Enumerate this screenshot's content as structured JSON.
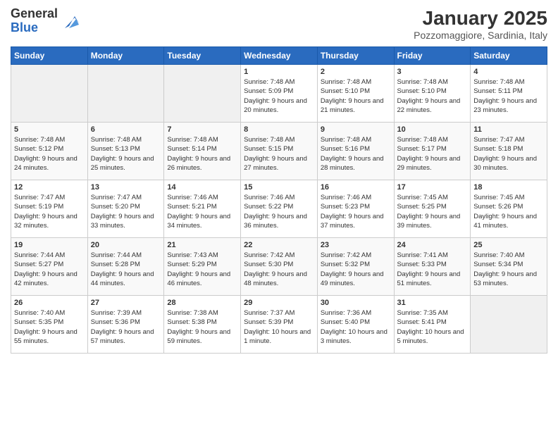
{
  "logo": {
    "general": "General",
    "blue": "Blue"
  },
  "title": "January 2025",
  "subtitle": "Pozzomaggiore, Sardinia, Italy",
  "headers": [
    "Sunday",
    "Monday",
    "Tuesday",
    "Wednesday",
    "Thursday",
    "Friday",
    "Saturday"
  ],
  "weeks": [
    [
      {
        "day": "",
        "sunrise": "",
        "sunset": "",
        "daylight": "",
        "empty": true
      },
      {
        "day": "",
        "sunrise": "",
        "sunset": "",
        "daylight": "",
        "empty": true
      },
      {
        "day": "",
        "sunrise": "",
        "sunset": "",
        "daylight": "",
        "empty": true
      },
      {
        "day": "1",
        "sunrise": "Sunrise: 7:48 AM",
        "sunset": "Sunset: 5:09 PM",
        "daylight": "Daylight: 9 hours and 20 minutes."
      },
      {
        "day": "2",
        "sunrise": "Sunrise: 7:48 AM",
        "sunset": "Sunset: 5:10 PM",
        "daylight": "Daylight: 9 hours and 21 minutes."
      },
      {
        "day": "3",
        "sunrise": "Sunrise: 7:48 AM",
        "sunset": "Sunset: 5:10 PM",
        "daylight": "Daylight: 9 hours and 22 minutes."
      },
      {
        "day": "4",
        "sunrise": "Sunrise: 7:48 AM",
        "sunset": "Sunset: 5:11 PM",
        "daylight": "Daylight: 9 hours and 23 minutes."
      }
    ],
    [
      {
        "day": "5",
        "sunrise": "Sunrise: 7:48 AM",
        "sunset": "Sunset: 5:12 PM",
        "daylight": "Daylight: 9 hours and 24 minutes."
      },
      {
        "day": "6",
        "sunrise": "Sunrise: 7:48 AM",
        "sunset": "Sunset: 5:13 PM",
        "daylight": "Daylight: 9 hours and 25 minutes."
      },
      {
        "day": "7",
        "sunrise": "Sunrise: 7:48 AM",
        "sunset": "Sunset: 5:14 PM",
        "daylight": "Daylight: 9 hours and 26 minutes."
      },
      {
        "day": "8",
        "sunrise": "Sunrise: 7:48 AM",
        "sunset": "Sunset: 5:15 PM",
        "daylight": "Daylight: 9 hours and 27 minutes."
      },
      {
        "day": "9",
        "sunrise": "Sunrise: 7:48 AM",
        "sunset": "Sunset: 5:16 PM",
        "daylight": "Daylight: 9 hours and 28 minutes."
      },
      {
        "day": "10",
        "sunrise": "Sunrise: 7:48 AM",
        "sunset": "Sunset: 5:17 PM",
        "daylight": "Daylight: 9 hours and 29 minutes."
      },
      {
        "day": "11",
        "sunrise": "Sunrise: 7:47 AM",
        "sunset": "Sunset: 5:18 PM",
        "daylight": "Daylight: 9 hours and 30 minutes."
      }
    ],
    [
      {
        "day": "12",
        "sunrise": "Sunrise: 7:47 AM",
        "sunset": "Sunset: 5:19 PM",
        "daylight": "Daylight: 9 hours and 32 minutes."
      },
      {
        "day": "13",
        "sunrise": "Sunrise: 7:47 AM",
        "sunset": "Sunset: 5:20 PM",
        "daylight": "Daylight: 9 hours and 33 minutes."
      },
      {
        "day": "14",
        "sunrise": "Sunrise: 7:46 AM",
        "sunset": "Sunset: 5:21 PM",
        "daylight": "Daylight: 9 hours and 34 minutes."
      },
      {
        "day": "15",
        "sunrise": "Sunrise: 7:46 AM",
        "sunset": "Sunset: 5:22 PM",
        "daylight": "Daylight: 9 hours and 36 minutes."
      },
      {
        "day": "16",
        "sunrise": "Sunrise: 7:46 AM",
        "sunset": "Sunset: 5:23 PM",
        "daylight": "Daylight: 9 hours and 37 minutes."
      },
      {
        "day": "17",
        "sunrise": "Sunrise: 7:45 AM",
        "sunset": "Sunset: 5:25 PM",
        "daylight": "Daylight: 9 hours and 39 minutes."
      },
      {
        "day": "18",
        "sunrise": "Sunrise: 7:45 AM",
        "sunset": "Sunset: 5:26 PM",
        "daylight": "Daylight: 9 hours and 41 minutes."
      }
    ],
    [
      {
        "day": "19",
        "sunrise": "Sunrise: 7:44 AM",
        "sunset": "Sunset: 5:27 PM",
        "daylight": "Daylight: 9 hours and 42 minutes."
      },
      {
        "day": "20",
        "sunrise": "Sunrise: 7:44 AM",
        "sunset": "Sunset: 5:28 PM",
        "daylight": "Daylight: 9 hours and 44 minutes."
      },
      {
        "day": "21",
        "sunrise": "Sunrise: 7:43 AM",
        "sunset": "Sunset: 5:29 PM",
        "daylight": "Daylight: 9 hours and 46 minutes."
      },
      {
        "day": "22",
        "sunrise": "Sunrise: 7:42 AM",
        "sunset": "Sunset: 5:30 PM",
        "daylight": "Daylight: 9 hours and 48 minutes."
      },
      {
        "day": "23",
        "sunrise": "Sunrise: 7:42 AM",
        "sunset": "Sunset: 5:32 PM",
        "daylight": "Daylight: 9 hours and 49 minutes."
      },
      {
        "day": "24",
        "sunrise": "Sunrise: 7:41 AM",
        "sunset": "Sunset: 5:33 PM",
        "daylight": "Daylight: 9 hours and 51 minutes."
      },
      {
        "day": "25",
        "sunrise": "Sunrise: 7:40 AM",
        "sunset": "Sunset: 5:34 PM",
        "daylight": "Daylight: 9 hours and 53 minutes."
      }
    ],
    [
      {
        "day": "26",
        "sunrise": "Sunrise: 7:40 AM",
        "sunset": "Sunset: 5:35 PM",
        "daylight": "Daylight: 9 hours and 55 minutes."
      },
      {
        "day": "27",
        "sunrise": "Sunrise: 7:39 AM",
        "sunset": "Sunset: 5:36 PM",
        "daylight": "Daylight: 9 hours and 57 minutes."
      },
      {
        "day": "28",
        "sunrise": "Sunrise: 7:38 AM",
        "sunset": "Sunset: 5:38 PM",
        "daylight": "Daylight: 9 hours and 59 minutes."
      },
      {
        "day": "29",
        "sunrise": "Sunrise: 7:37 AM",
        "sunset": "Sunset: 5:39 PM",
        "daylight": "Daylight: 10 hours and 1 minute."
      },
      {
        "day": "30",
        "sunrise": "Sunrise: 7:36 AM",
        "sunset": "Sunset: 5:40 PM",
        "daylight": "Daylight: 10 hours and 3 minutes."
      },
      {
        "day": "31",
        "sunrise": "Sunrise: 7:35 AM",
        "sunset": "Sunset: 5:41 PM",
        "daylight": "Daylight: 10 hours and 5 minutes."
      },
      {
        "day": "",
        "sunrise": "",
        "sunset": "",
        "daylight": "",
        "empty": true
      }
    ]
  ]
}
